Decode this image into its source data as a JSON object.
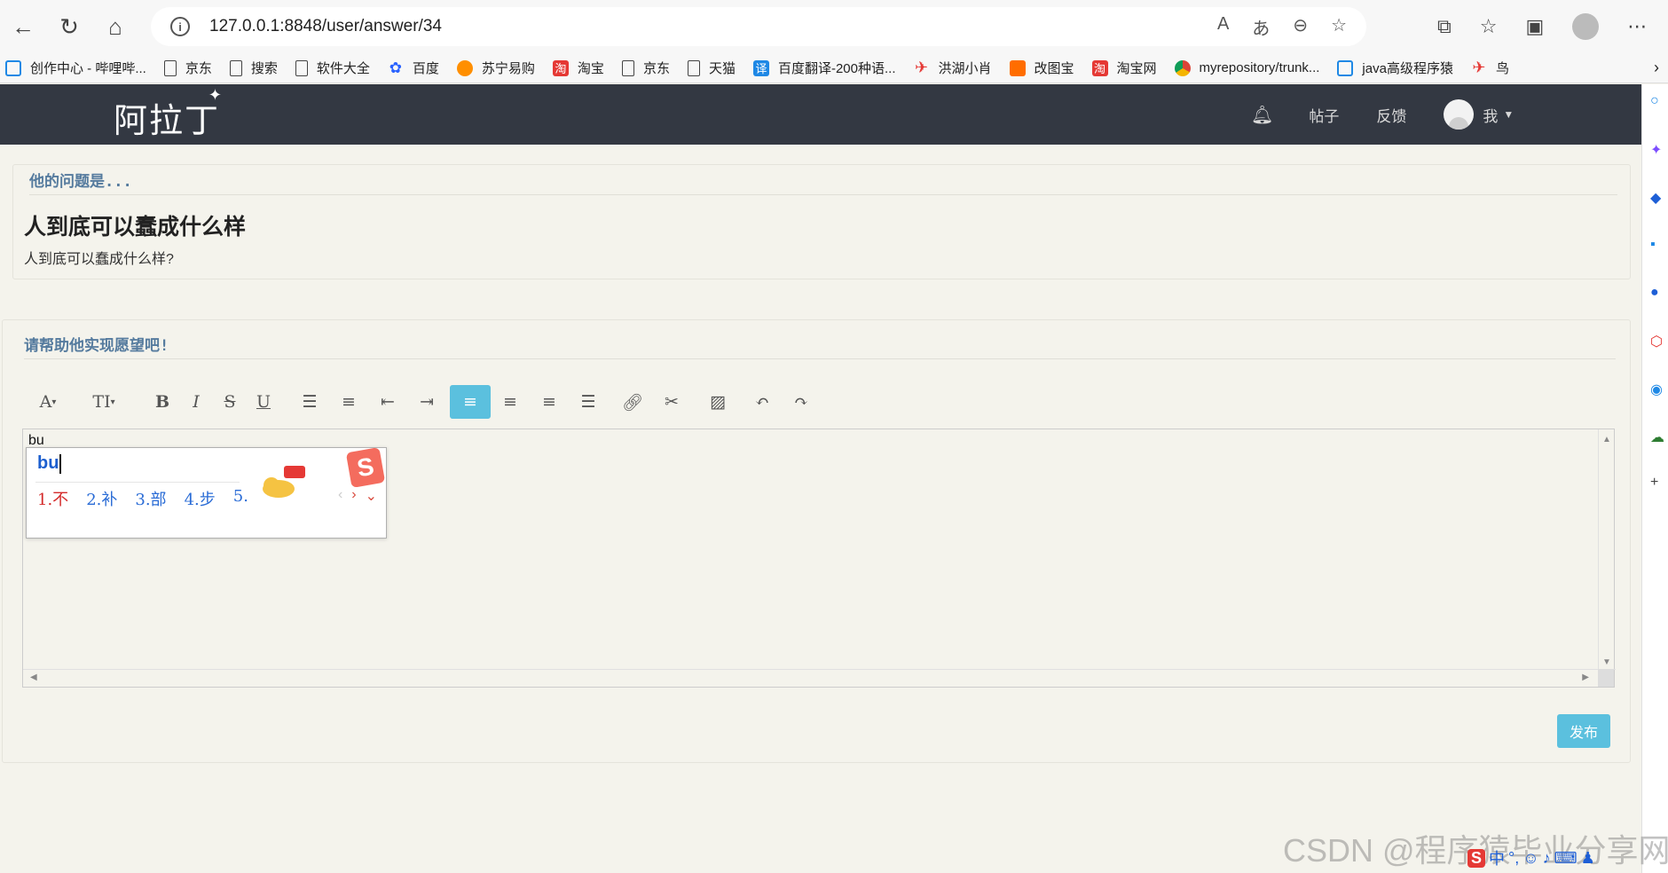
{
  "browser": {
    "url": "127.0.0.1:8848/user/answer/34",
    "bookmarks": [
      {
        "label": "创作中心 - 哔哩哔...",
        "icon": "tv-icon"
      },
      {
        "label": "京东",
        "icon": "page-icon"
      },
      {
        "label": "搜索",
        "icon": "page-icon"
      },
      {
        "label": "软件大全",
        "icon": "page-icon"
      },
      {
        "label": "百度",
        "icon": "paw-icon"
      },
      {
        "label": "苏宁易购",
        "icon": "suning-icon"
      },
      {
        "label": "淘宝",
        "icon": "taobao-icon"
      },
      {
        "label": "京东",
        "icon": "page-icon"
      },
      {
        "label": "天猫",
        "icon": "page-icon"
      },
      {
        "label": "百度翻译-200种语...",
        "icon": "translate-icon"
      },
      {
        "label": "洪湖小肖",
        "icon": "bird-icon"
      },
      {
        "label": "改图宝",
        "icon": "folder-icon"
      },
      {
        "label": "淘宝网",
        "icon": "taobao-icon"
      },
      {
        "label": "myrepository/trunk...",
        "icon": "chrome-icon"
      },
      {
        "label": "java高级程序猿",
        "icon": "tv-icon"
      },
      {
        "label": "鸟",
        "icon": "bird-icon"
      }
    ]
  },
  "navbar": {
    "logo": "阿拉丁",
    "links": [
      "帖子",
      "反馈"
    ],
    "user_label": "我"
  },
  "question": {
    "header": "他的问题是...",
    "title": "人到底可以蠢成什么样",
    "body": "人到底可以蠢成什么样?"
  },
  "answer": {
    "header": "请帮助他实现愿望吧!",
    "editor_text": "bu",
    "publish_label": "发布"
  },
  "toolbar": {
    "font_label": "A",
    "size_label": "TI"
  },
  "ime": {
    "composition": "bu",
    "candidates": [
      "1.不",
      "2.补",
      "3.部",
      "4.步",
      "5."
    ]
  },
  "watermark": "CSDN @程序猿毕业分享网",
  "tray": {
    "mode": "中"
  }
}
